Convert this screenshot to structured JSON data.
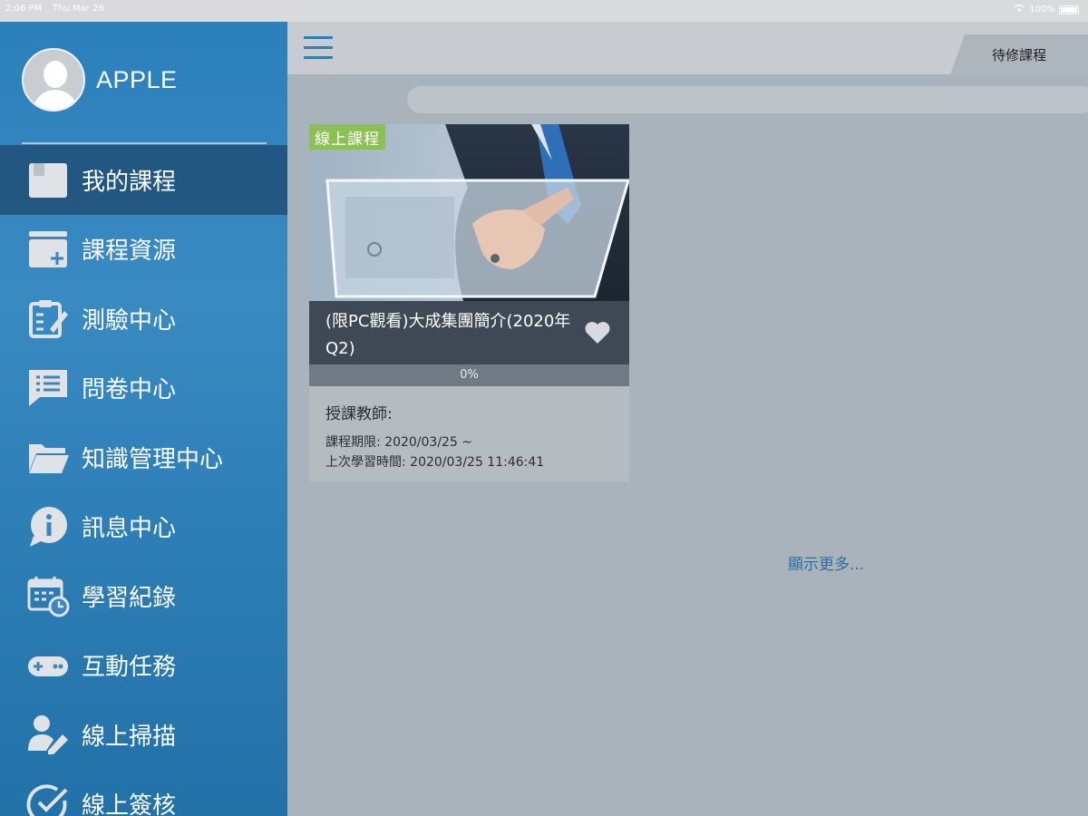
{
  "status_bar": {
    "time": "2:06 PM",
    "date": "Thu Mar 26",
    "battery": "100%"
  },
  "profile": {
    "username": "APPLE"
  },
  "sidebar": {
    "items": [
      {
        "label": "我的課程",
        "icon": "book-icon",
        "active": true
      },
      {
        "label": "課程資源",
        "icon": "folder-add-icon",
        "active": false
      },
      {
        "label": "測驗中心",
        "icon": "clipboard-edit-icon",
        "active": false
      },
      {
        "label": "問卷中心",
        "icon": "survey-list-icon",
        "active": false
      },
      {
        "label": "知識管理中心",
        "icon": "folder-open-icon",
        "active": false
      },
      {
        "label": "訊息中心",
        "icon": "info-bubble-icon",
        "active": false
      },
      {
        "label": "學習紀錄",
        "icon": "calendar-clock-icon",
        "active": false
      },
      {
        "label": "互動任務",
        "icon": "gamepad-icon",
        "active": false
      },
      {
        "label": "線上掃描",
        "icon": "user-edit-icon",
        "active": false
      },
      {
        "label": "線上簽核",
        "icon": "check-circle-icon",
        "active": false
      }
    ]
  },
  "header": {
    "tab_label": "待修課程"
  },
  "course": {
    "badge": "線上課程",
    "title": "(限PC觀看)大成集團簡介(2020年Q2)",
    "progress_value": 0,
    "progress_text": "0%",
    "teacher_label": "授課教師:",
    "period": "課程期限: 2020/03/25 ~",
    "last_learn": "上次學習時間: 2020/03/25 11:46:41"
  },
  "show_more": "顯示更多...",
  "colors": {
    "sidebar": "#2f80b8",
    "accent": "#2f7db4",
    "badge": "#8cbf56"
  }
}
